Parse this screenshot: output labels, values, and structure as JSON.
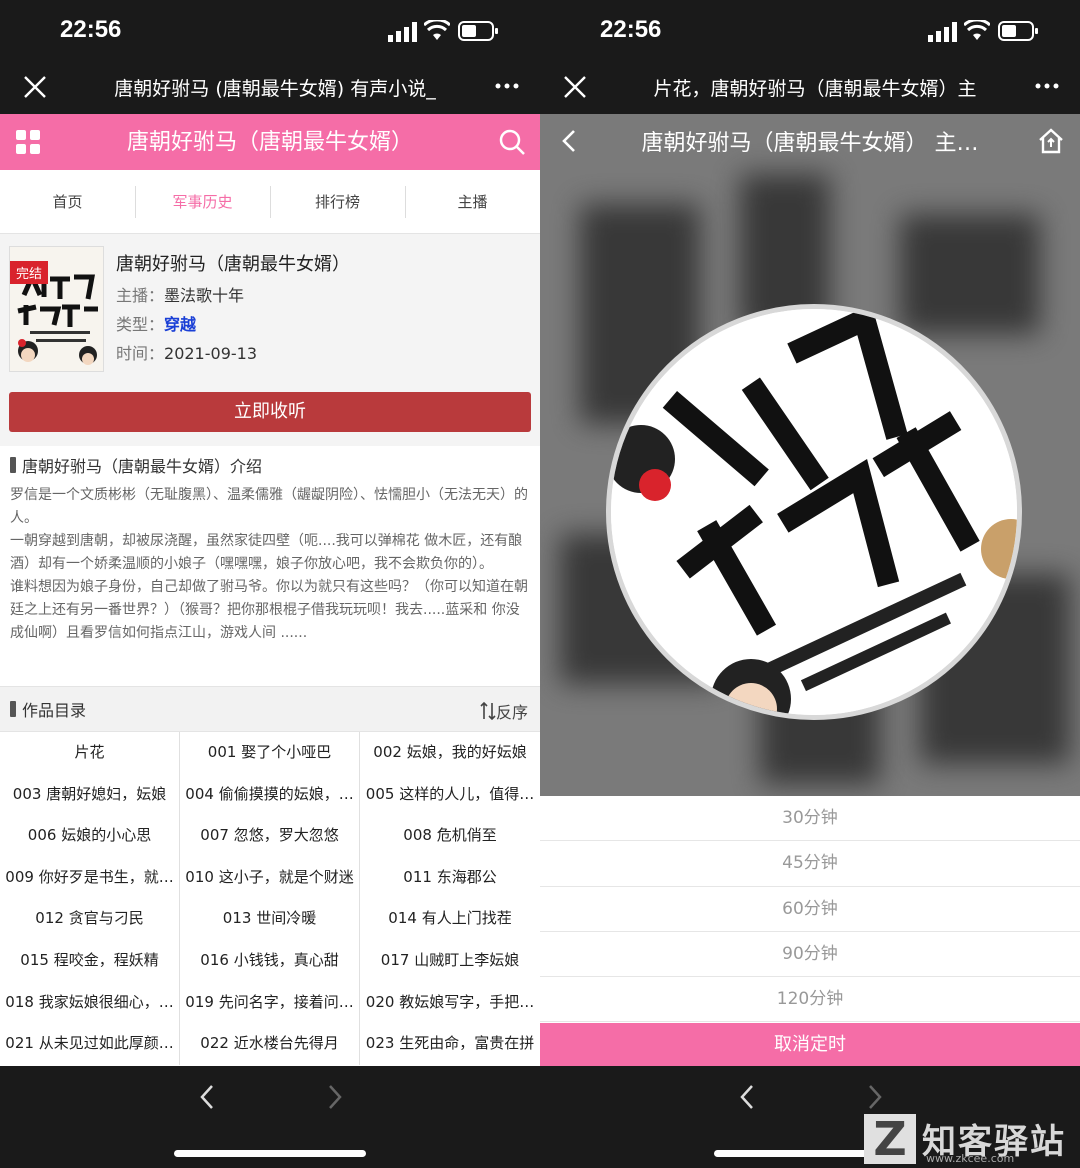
{
  "status": {
    "time": "22:56"
  },
  "left": {
    "wx_title": "唐朝好驸马 (唐朝最牛女婿) 有声小说_",
    "header_title": "唐朝好驸马（唐朝最牛女婿）",
    "nav": [
      "首页",
      "军事历史",
      "排行榜",
      "主播"
    ],
    "book": {
      "status_tag": "完结",
      "title": "唐朝好驸马（唐朝最牛女婿）",
      "anchor_label": "主播：",
      "anchor": "墨法歌十年",
      "type_label": "类型：",
      "type": "穿越",
      "time_label": "时间：",
      "time": "2021-09-13",
      "listen_button": "立即收听"
    },
    "intro": {
      "heading": "唐朝好驸马（唐朝最牛女婿）介绍",
      "paragraphs": [
        "罗信是一个文质彬彬（无耻腹黑）、温柔儒雅（龌龊阴险）、怯懦胆小（无法无天）的人。",
        "一朝穿越到唐朝，却被尿浇醒，虽然家徒四壁（呃....我可以弹棉花 做木匠，还有酿酒）却有一个娇柔温顺的小娘子（嘿嘿嘿，娘子你放心吧，我不会欺负你的）。",
        "谁料想因为娘子身份，自己却做了驸马爷。你以为就只有这些吗？（你可以知道在朝廷之上还有另一番世界？）（猴哥？把你那根棍子借我玩玩呗！我去.....蓝采和 你没成仙啊）且看罗信如何指点江山，游戏人间 ......"
      ]
    },
    "toc": {
      "heading": "作品目录",
      "reverse": "反序",
      "items": [
        "片花",
        "001 娶了个小哑巴",
        "002 妘娘，我的好妘娘",
        "003 唐朝好媳妇，妘娘",
        "004 偷偷摸摸的妘娘，…",
        "005 这样的人儿，值得…",
        "006 妘娘的小心思",
        "007 忽悠，罗大忽悠",
        "008 危机俏至",
        "009 你好歹是书生，就…",
        "010 这小子，就是个财迷",
        "011 东海郡公",
        "012 贪官与刁民",
        "013 世间冷暖",
        "014 有人上门找茬",
        "015 程咬金，程妖精",
        "016 小钱钱，真心甜",
        "017 山贼盯上李妘娘",
        "018 我家妘娘很细心，…",
        "019 先问名字，接着问…",
        "020 教妘娘写字，手把…",
        "021 从未见过如此厚颜…",
        "022 近水楼台先得月",
        "023 生死由命，富贵在拼"
      ]
    }
  },
  "right": {
    "wx_title": "片花，唐朝好驸马（唐朝最牛女婿）主",
    "header_title": "唐朝好驸马（唐朝最牛女婿） 主…",
    "timer_options": [
      "30分钟",
      "45分钟",
      "60分钟",
      "90分钟",
      "120分钟"
    ],
    "cancel_timer": "取消定时"
  },
  "watermark": {
    "name": "知客驿站",
    "url": "www.zkcee.com",
    "logo": "Z"
  },
  "colors": {
    "accent": "#f56da7",
    "listen": "#b93a3c",
    "type_link": "#1a3fd6"
  }
}
